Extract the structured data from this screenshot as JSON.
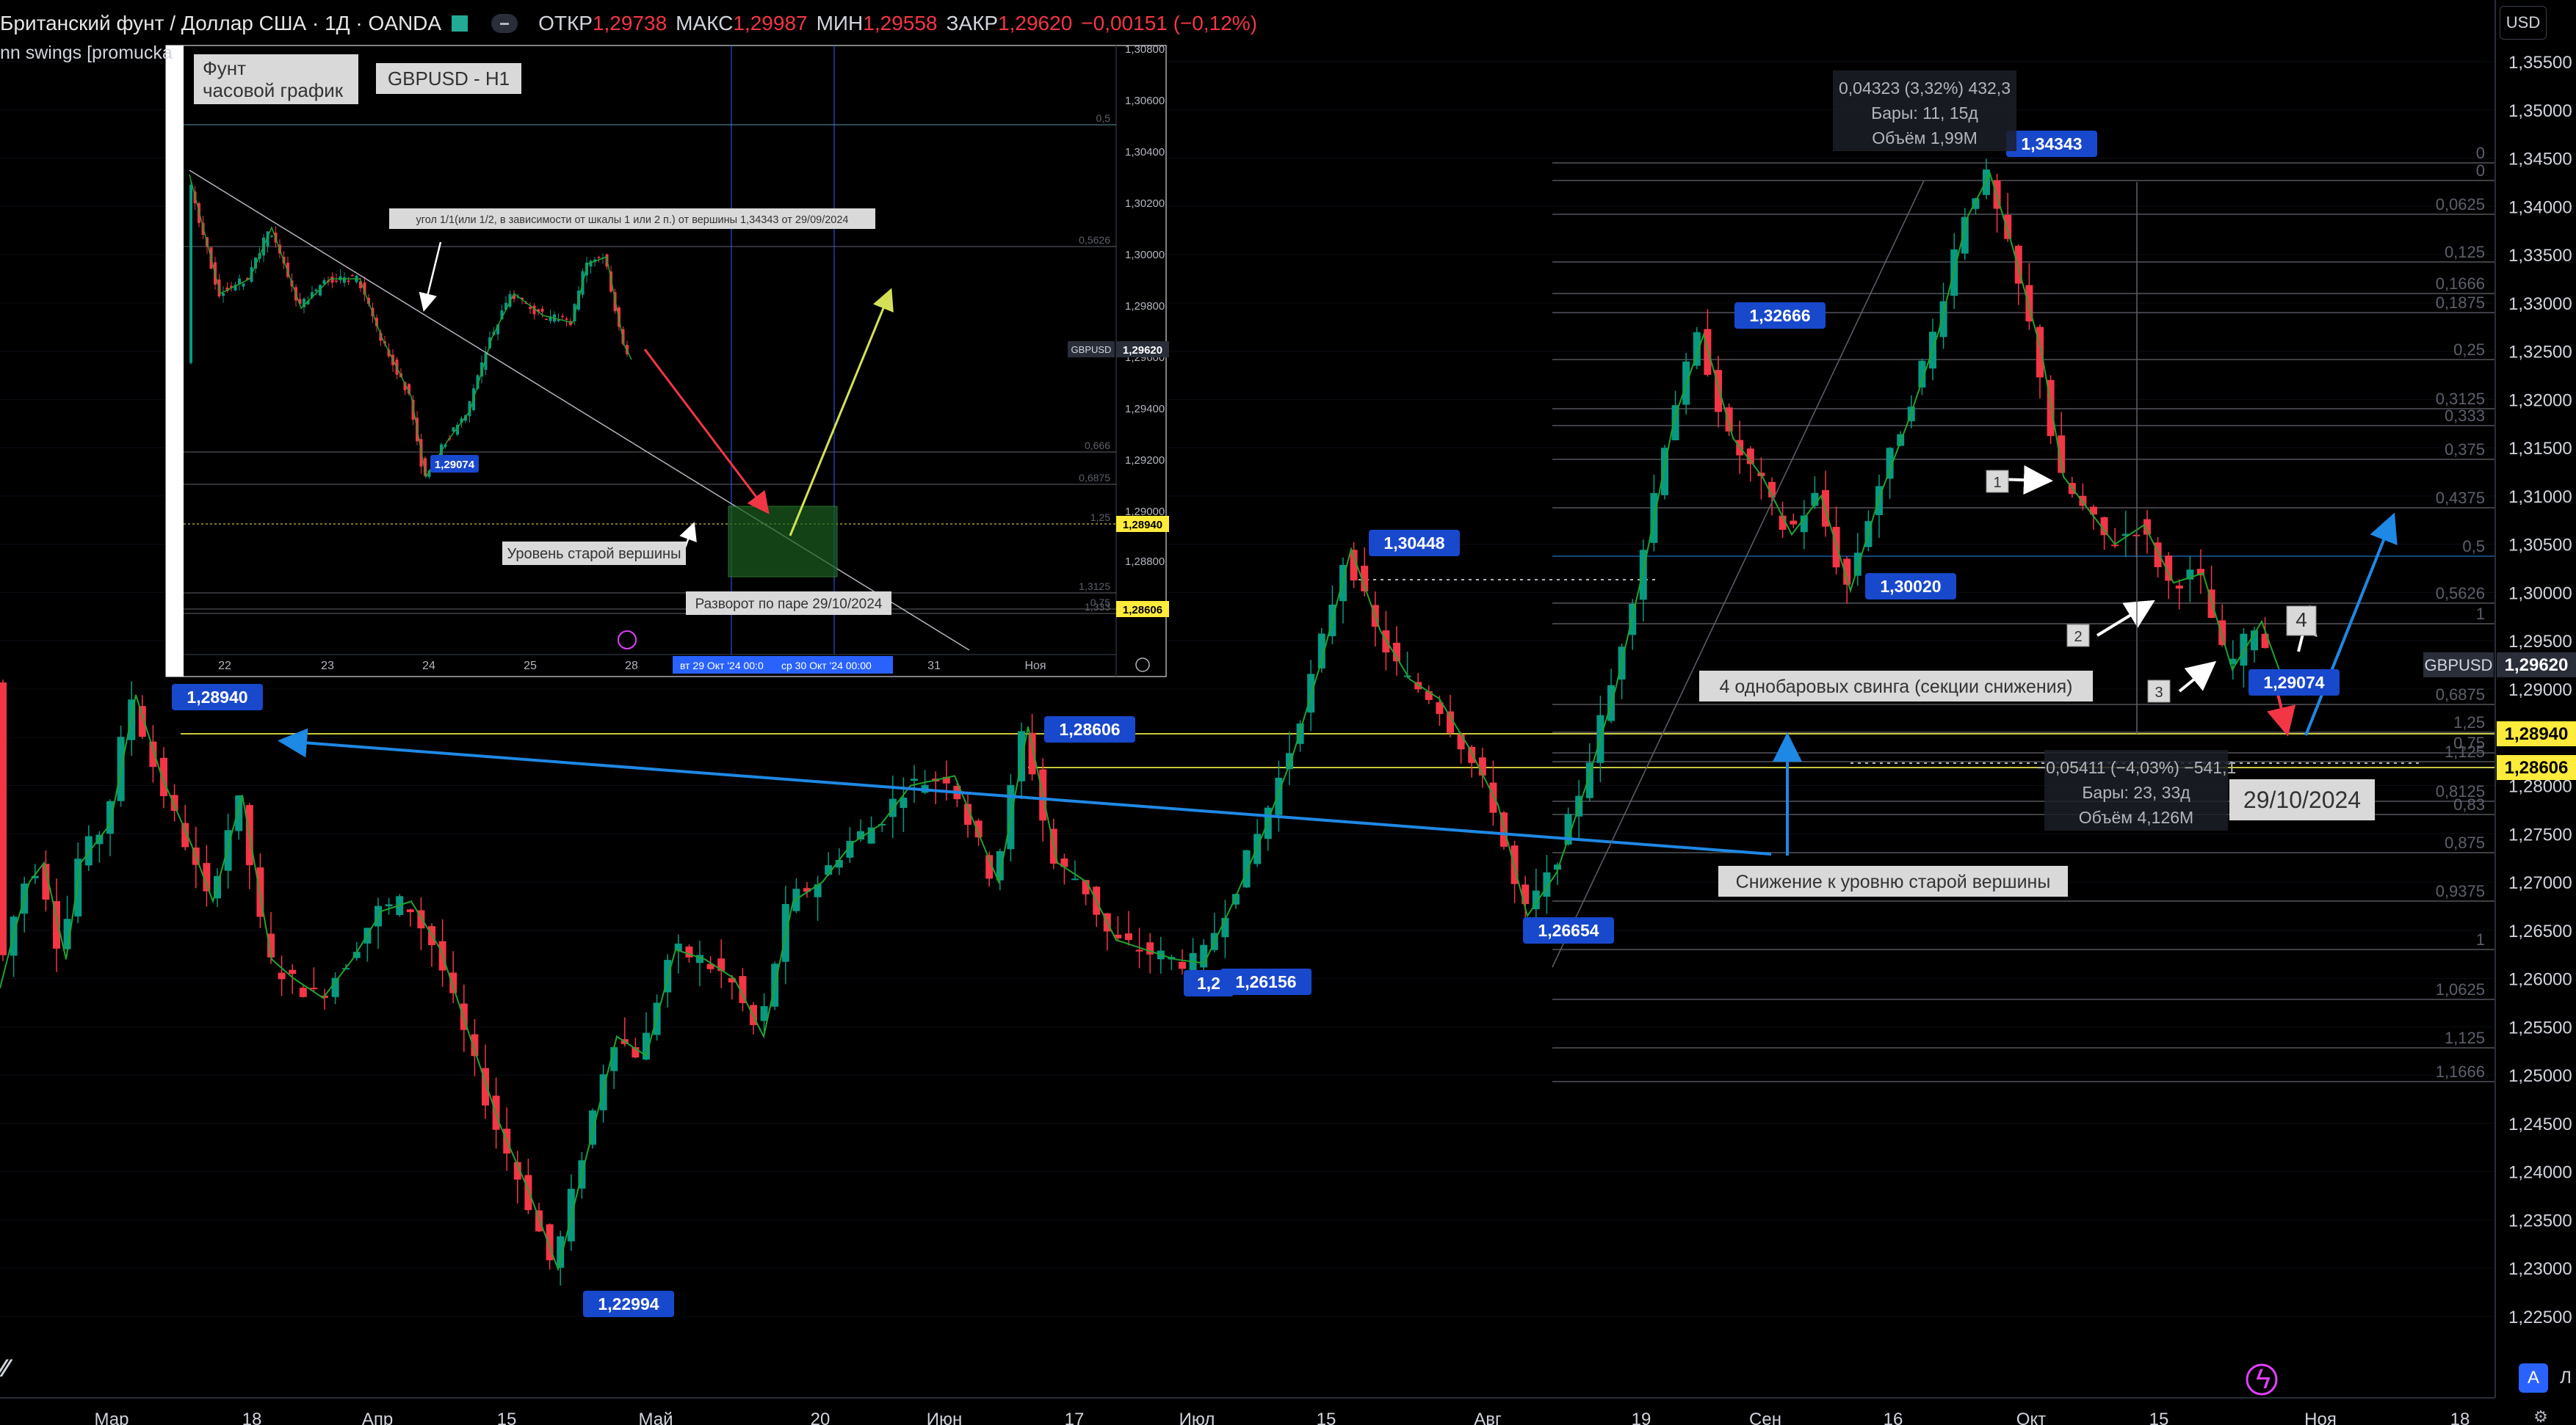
{
  "header": {
    "symbol_title": "Британский фунт / Доллар США · 1Д · OANDA",
    "open_label": "ОТКР",
    "open_value": "1,29738",
    "high_label": "МАКС",
    "high_value": "1,29987",
    "low_label": "МИН",
    "low_value": "1,29558",
    "close_label": "ЗАКР",
    "close_value": "1,29620",
    "change": "−0,00151 (−0,12%)"
  },
  "indicator_label": "nn swings [promucka",
  "currency_button": "USD",
  "price_scale": [
    "1,35500",
    "1,35000",
    "1,34500",
    "1,34000",
    "1,33500",
    "1,33000",
    "1,32500",
    "1,32000",
    "1,31500",
    "1,31000",
    "1,30500",
    "1,30000",
    "1,29500",
    "1,29000",
    "1,28500",
    "1,28000",
    "1,27500",
    "1,27000",
    "1,26500",
    "1,26000",
    "1,25500",
    "1,25000",
    "1,24500",
    "1,24000",
    "1,23500",
    "1,23000",
    "1,22500"
  ],
  "price_badges": [
    {
      "text": "GBPUSD",
      "value": "1,29620",
      "style": "symbol"
    },
    {
      "text": "",
      "value": "1,28940",
      "style": "yellow"
    },
    {
      "text": "",
      "value": "1,28606",
      "style": "yellow"
    }
  ],
  "time_scale": [
    "Мар",
    "18",
    "Апр",
    "15",
    "Май",
    "20",
    "Июн",
    "17",
    "Июл",
    "15",
    "Авг",
    "19",
    "Сен",
    "16",
    "Окт",
    "15",
    "Ноя",
    "18"
  ],
  "price_labels": [
    {
      "text": "1,28940",
      "kind": "high"
    },
    {
      "text": "1,22994",
      "kind": "low"
    },
    {
      "text": "1,28606",
      "kind": "high"
    },
    {
      "text": "1,26156",
      "kind": "low"
    },
    {
      "text": "1,2",
      "kind": "low"
    },
    {
      "text": "1,30448",
      "kind": "high"
    },
    {
      "text": "1,26654",
      "kind": "low"
    },
    {
      "text": "1,32666",
      "kind": "high"
    },
    {
      "text": "1,30020",
      "kind": "low"
    },
    {
      "text": "1,34343",
      "kind": "high"
    },
    {
      "text": "1,29074",
      "kind": "low"
    }
  ],
  "fib_levels": [
    "0",
    "0",
    "0,0625",
    "0,125",
    "0,1666",
    "0,1875",
    "0,25",
    "0,3125",
    "0,333",
    "0,375",
    "0,4375",
    "0,5",
    "0,5626",
    "1",
    "0,6875",
    "0,75",
    "1,25",
    "1,125",
    "0,8125",
    "0,83",
    "0,875",
    "0,9375",
    "1",
    "1,0625",
    "1,125",
    "1,1666"
  ],
  "measure_top": {
    "line1": "0,04323 (3,32%) 432,3",
    "line2": "Бары: 11, 15д",
    "line3": "Объём 1,99M"
  },
  "measure_bottom": {
    "line1": "−0,05411 (−4,03%) −541,1",
    "line2": "Бары: 23, 33д",
    "line3": "Объём 4,126M"
  },
  "annotations": {
    "swings_note": "4 однобаровых свинга (секции снижения)",
    "decline_note": "Снижение к уровню старой вершины",
    "date_note": "29/10/2024",
    "wave_numbers": [
      "1",
      "2",
      "3",
      "4"
    ]
  },
  "inset": {
    "title_line1": "Фунт",
    "title_line2": "часовой график",
    "symbol": "GBPUSD - H1",
    "angle_note": "угол 1/1(или 1/2, в зависимости от шкалы 1 или 2 п.) от вершины 1,34343 от 29/09/2024",
    "old_top_note": "Уровень старой вершины",
    "reversal_note": "Разворот по паре 29/10/2024",
    "low_label": "1,29074",
    "price_scale": [
      "1,30800",
      "1,30600",
      "1,30400",
      "1,30200",
      "1,30000",
      "1,29800",
      "1,29600",
      "1,29400",
      "1,29200",
      "1,29000",
      "1,28800",
      "1,28600"
    ],
    "badges": [
      {
        "text": "GBPUSD",
        "value": "1,29620"
      },
      {
        "text": "",
        "value": "1,28940"
      },
      {
        "text": "",
        "value": "1,28606"
      }
    ],
    "fib_tags": [
      "0,5",
      "0,5626",
      "0,666",
      "0,6875",
      "1,25",
      "1,3125",
      "0,75",
      "1,333"
    ],
    "time_scale": [
      "22",
      "23",
      "24",
      "25",
      "28",
      "31",
      "Ноя"
    ],
    "time_highlight1": "вт 29 Окт '24   00:0",
    "time_highlight2": "ср 30 Окт '24   00:00"
  },
  "colors": {
    "background": "#000000",
    "up": "#089981",
    "down": "#f23645",
    "swing": "#22a32e",
    "trend_blue": "#1e88e5",
    "label_blue": "#1848cc",
    "yellow_level": "#c8c83c",
    "fib_line": "#787b86"
  },
  "icons": [
    "tv-logo-icon",
    "flash-icon",
    "settings-icon",
    "chart-flag-icon",
    "eye-toggle-icon"
  ]
}
